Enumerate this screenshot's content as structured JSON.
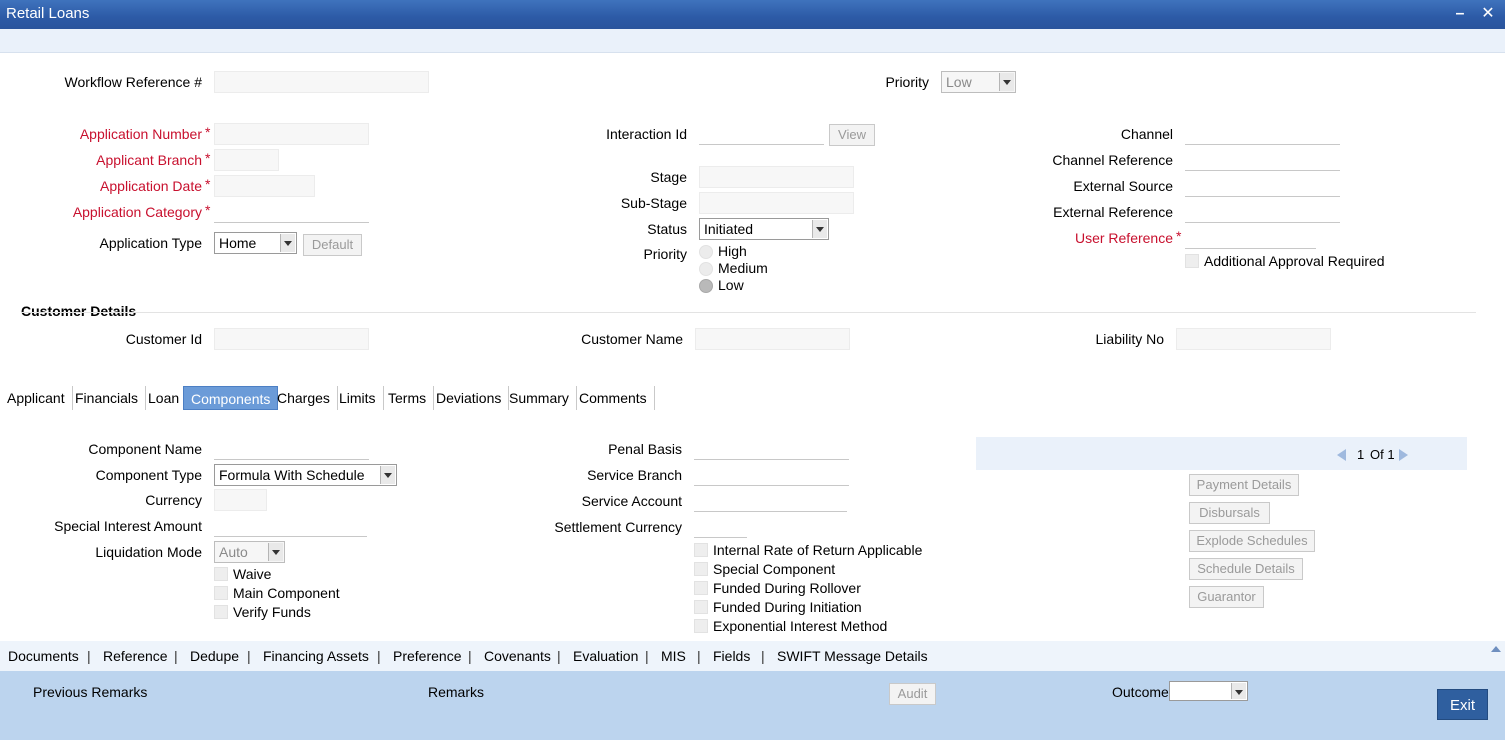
{
  "window": {
    "title": "Retail Loans",
    "minimize_glyph": "–",
    "close_glyph": "✕"
  },
  "header": {
    "workflow_ref_label": "Workflow Reference #",
    "workflow_ref_value": "",
    "priority_label": "Priority",
    "priority_value": "Low"
  },
  "application": {
    "number_label": "Application Number",
    "branch_label": "Applicant Branch",
    "date_label": "Application Date",
    "category_label": "Application Category",
    "type_label": "Application Type",
    "type_value": "Home",
    "default_button": "Default",
    "required_mark": "*"
  },
  "interaction": {
    "interaction_id_label": "Interaction Id",
    "view_button": "View",
    "stage_label": "Stage",
    "sub_stage_label": "Sub-Stage",
    "status_label": "Status",
    "status_value": "Initiated",
    "priority_label": "Priority",
    "priority_options": [
      "High",
      "Medium",
      "Low"
    ],
    "priority_selected": "Low"
  },
  "channel": {
    "channel_label": "Channel",
    "channel_reference_label": "Channel Reference",
    "external_source_label": "External Source",
    "external_reference_label": "External Reference",
    "user_reference_label": "User Reference",
    "additional_approval_label": "Additional Approval Required"
  },
  "customer": {
    "section_title": "Customer Details",
    "customer_id_label": "Customer Id",
    "customer_name_label": "Customer Name",
    "liability_no_label": "Liability No"
  },
  "tabs": [
    "Applicant",
    "Financials",
    "Loan",
    "Components",
    "Charges",
    "Limits",
    "Terms",
    "Deviations",
    "Summary",
    "Comments"
  ],
  "active_tab": "Components",
  "components": {
    "component_name_label": "Component Name",
    "component_type_label": "Component Type",
    "component_type_value": "Formula With Schedule",
    "currency_label": "Currency",
    "special_interest_label": "Special Interest Amount",
    "liquidation_mode_label": "Liquidation Mode",
    "liquidation_mode_value": "Auto",
    "waive_label": "Waive",
    "main_component_label": "Main Component",
    "verify_funds_label": "Verify Funds",
    "penal_basis_label": "Penal Basis",
    "service_branch_label": "Service Branch",
    "service_account_label": "Service Account",
    "settlement_currency_label": "Settlement Currency",
    "irr_label": "Internal Rate of Return Applicable",
    "special_component_label": "Special Component",
    "funded_rollover_label": "Funded During Rollover",
    "funded_initiation_label": "Funded During Initiation",
    "exponential_label": "Exponential Interest Method",
    "pager_current": "1",
    "pager_of": "Of 1",
    "payment_details_button": "Payment Details",
    "disbursals_button": "Disbursals",
    "explode_schedules_button": "Explode Schedules",
    "schedule_details_button": "Schedule Details",
    "guarantor_button": "Guarantor"
  },
  "bottom_links": [
    "Documents",
    "Reference",
    "Dedupe",
    "Financing Assets",
    "Preference",
    "Covenants",
    "Evaluation",
    "MIS",
    "Fields",
    "SWIFT Message Details"
  ],
  "bottom_separator": "|",
  "footer": {
    "previous_remarks_label": "Previous Remarks",
    "remarks_label": "Remarks",
    "audit_button": "Audit",
    "outcome_label": "Outcome",
    "outcome_value": "",
    "exit_button": "Exit"
  },
  "colors": {
    "title_bar": "#2c5aa6",
    "required_label": "#c8102e",
    "active_tab": "#6b9bd8",
    "footer": "#bcd4ee",
    "exit_button": "#2f5f9f"
  }
}
